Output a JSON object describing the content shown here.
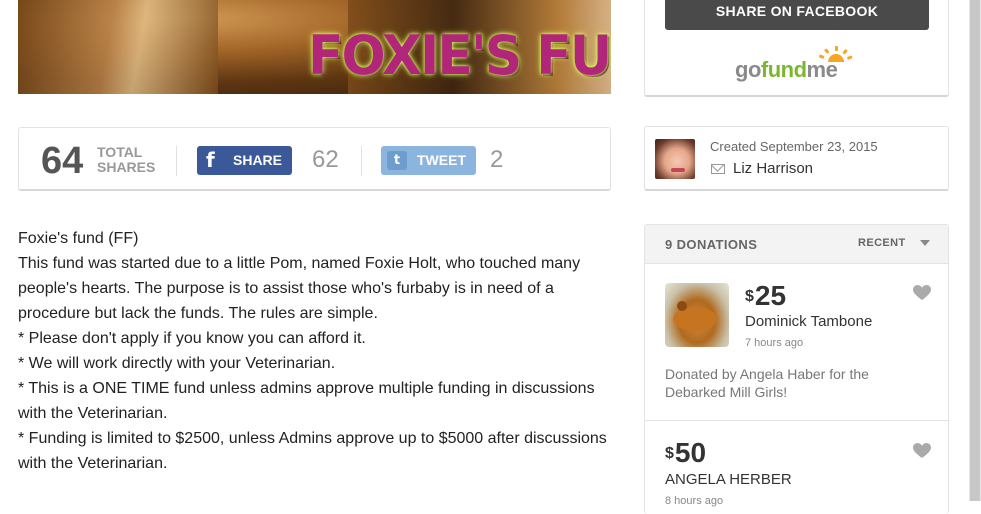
{
  "hero": {
    "title": "FOXIE'S FUND"
  },
  "share_bar": {
    "total": "64",
    "total_label_1": "TOTAL",
    "total_label_2": "SHARES",
    "facebook_icon": "f",
    "facebook_label": "SHARE",
    "facebook_count": "62",
    "twitter_icon": "t",
    "twitter_label": "TWEET",
    "twitter_count": "2"
  },
  "story": {
    "lines": [
      "Foxie's fund (FF)",
      "This fund was started due to a little Pom, named Foxie Holt, who touched many people's hearts. The purpose is to assist those who's furbaby is in need of a procedure but lack the funds. The rules are simple.",
      "* Please don't apply if you know you can afford it.",
      "* We will work directly with your Veterinarian.",
      "* This is a ONE TIME fund unless admins approve multiple funding in discussions with the Veterinarian.",
      "* Funding is limited to $2500, unless Admins approve up to $5000 after discussions with the Veterinarian."
    ]
  },
  "sidebar": {
    "share_facebook_label": "SHARE ON FACEBOOK",
    "logo": {
      "go": "go",
      "fund": "fund",
      "me": "me"
    },
    "organizer": {
      "created": "Created September 23, 2015",
      "name": "Liz Harrison",
      "icons": [
        "avatar-photo",
        "mail-icon"
      ]
    },
    "donations": {
      "header": "9 DONATIONS",
      "sort_label": "RECENT",
      "items": [
        {
          "currency": "$",
          "amount": "25",
          "name": "Dominick Tambone",
          "time": "7 hours ago",
          "note": "Donated by Angela Haber for the Debarked Mill Girls!"
        },
        {
          "currency": "$",
          "amount": "50",
          "name": "ANGELA HERBER",
          "time": "8 hours ago"
        }
      ]
    }
  },
  "colors": {
    "facebook": "#3b5998",
    "twitter": "#8bb4de",
    "gfm_green": "#7ab82f",
    "gfm_orange": "#f5a623",
    "dark_button": "#4a4a4a",
    "hero_title": "#b2267a"
  }
}
